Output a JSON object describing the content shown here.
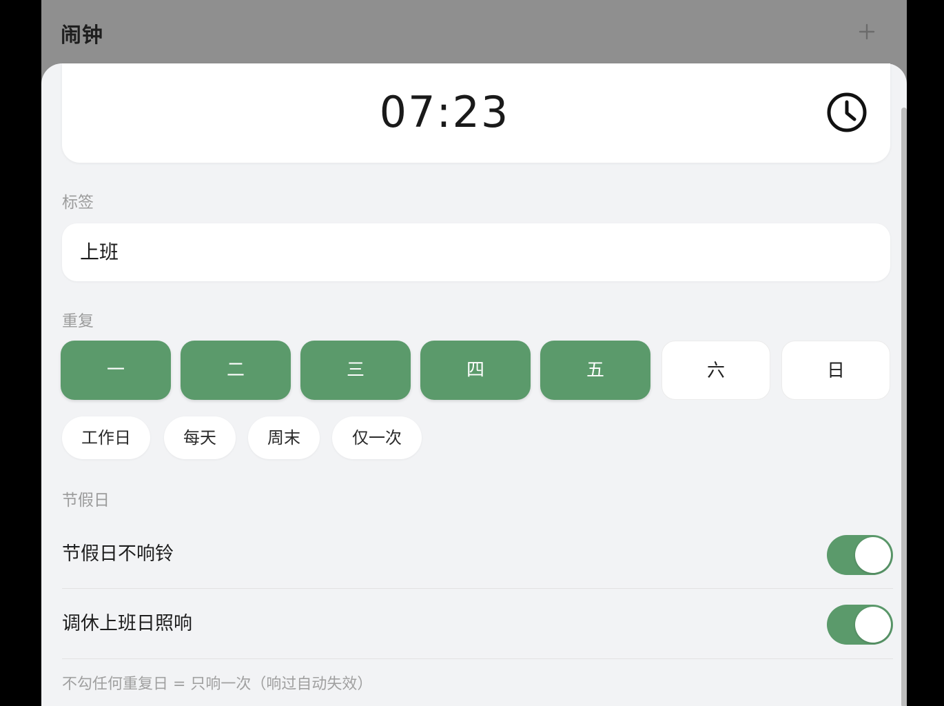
{
  "header": {
    "title": "闹钟",
    "add_icon": "plus-icon"
  },
  "time": {
    "value": "07:23",
    "icon": "clock-icon"
  },
  "label_section": {
    "title": "标签",
    "value": "上班"
  },
  "repeat_section": {
    "title": "重复",
    "days": [
      {
        "label": "一",
        "selected": true
      },
      {
        "label": "二",
        "selected": true
      },
      {
        "label": "三",
        "selected": true
      },
      {
        "label": "四",
        "selected": true
      },
      {
        "label": "五",
        "selected": true
      },
      {
        "label": "六",
        "selected": false
      },
      {
        "label": "日",
        "selected": false
      }
    ],
    "presets": [
      "工作日",
      "每天",
      "周末",
      "仅一次"
    ]
  },
  "holiday_section": {
    "title": "节假日",
    "rows": [
      {
        "label": "节假日不响铃",
        "enabled": true
      },
      {
        "label": "调休上班日照响",
        "enabled": true
      }
    ],
    "note": "不勾任何重复日 = 只响一次（响过自动失效）"
  },
  "colors": {
    "accent": "#5b9a6b",
    "background": "#f2f3f5",
    "card": "#ffffff"
  }
}
